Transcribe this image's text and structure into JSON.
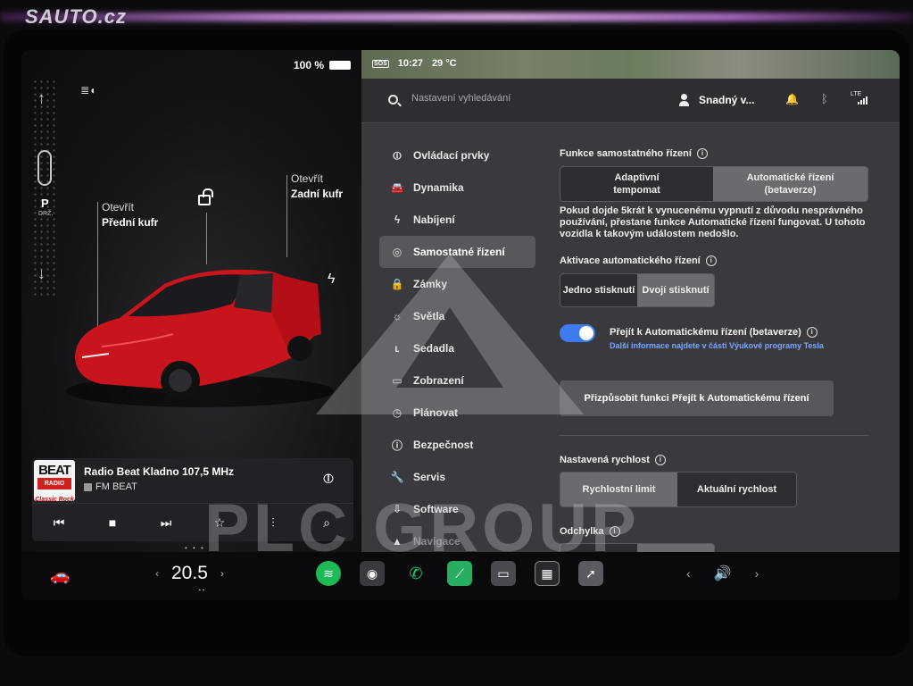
{
  "watermark_top": "SAUTO.cz",
  "watermark_center": "PLC GROUP",
  "left_panel": {
    "battery_text": "100 %",
    "gear": "P",
    "gear_sub": "DRŽ.",
    "frunk": {
      "line1": "Otevřít",
      "line2": "Přední kufr"
    },
    "trunk": {
      "line1": "Otevřít",
      "line2": "Zadní kufr"
    }
  },
  "media": {
    "art": {
      "beat": "BEAT",
      "radio": "RADIO",
      "sub": "Classic Rock"
    },
    "title": "Radio Beat Kladno 107,5 MHz",
    "subtitle": "FM BEAT",
    "controls": [
      "⏮",
      "■",
      "⏭",
      "☆",
      "⫶",
      "⌕"
    ],
    "pager": "• • •"
  },
  "status_bar": {
    "sos": "SOS",
    "time": "10:27",
    "temperature": "29 °C"
  },
  "topbar": {
    "search_placeholder": "Nastavení vyhledávání",
    "profile_name": "Snadný v...",
    "lte": "LTE"
  },
  "nav": {
    "items": [
      {
        "label": "Ovládací prvky",
        "icon": "⏼"
      },
      {
        "label": "Dynamika",
        "icon": "🚘"
      },
      {
        "label": "Nabíjení",
        "icon": "ϟ"
      },
      {
        "label": "Samostatné řízení",
        "icon": "◎"
      },
      {
        "label": "Zámky",
        "icon": "🔒"
      },
      {
        "label": "Světla",
        "icon": "☼"
      },
      {
        "label": "Sedadla",
        "icon": "ʟ"
      },
      {
        "label": "Zobrazení",
        "icon": "▭"
      },
      {
        "label": "Plánovat",
        "icon": "◷"
      },
      {
        "label": "Bezpečnost",
        "icon": "ⓘ"
      },
      {
        "label": "Servis",
        "icon": "🔧"
      },
      {
        "label": "Software",
        "icon": "⇩"
      },
      {
        "label": "Navigace",
        "icon": "▲"
      }
    ]
  },
  "content": {
    "funkce": {
      "title": "Funkce samostatného řízení",
      "option1_line1": "Adaptivní",
      "option1_line2": "tempomat",
      "option2_line1": "Automatické řízení",
      "option2_line2": "(betaverze)",
      "warning": "Pokud dojde 5krát k vynucenému vypnutí z důvodu nesprávného používání, přestane funkce Automatické řízení fungovat. U tohoto vozidla k takovým událostem nedošlo."
    },
    "aktivace": {
      "title": "Aktivace automatického řízení",
      "option1": "Jedno stisknutí",
      "option2": "Dvojí stisknutí"
    },
    "prejit": {
      "label": "Přejít k Automatickému řízení (betaverze)",
      "link": "Další informace najdete v části Výukové programy Tesla",
      "enabled": true
    },
    "customize_button": "Přizpůsobit funkci Přejít k Automatickému řízení",
    "rychlost": {
      "title": "Nastavená rychlost",
      "option1": "Rychlostní limit",
      "option2": "Aktuální rychlost"
    },
    "odchylka": {
      "title": "Odchylka"
    }
  },
  "dock": {
    "temp_left_arrow": "‹",
    "temp_value": "20.5",
    "temp_right_arrow": "›",
    "vol_left": "‹",
    "vol_right": "›",
    "apps": [
      "spotify-icon",
      "camera-icon",
      "phone-icon",
      "energy-icon",
      "glovebox-icon",
      "app-launcher-icon",
      "navigation-icon"
    ]
  },
  "colors": {
    "accent_blue": "#3e7bf0",
    "link_blue": "#79a6ff",
    "car_red": "#d11a22",
    "settings_bg": "#3a3a3e"
  }
}
